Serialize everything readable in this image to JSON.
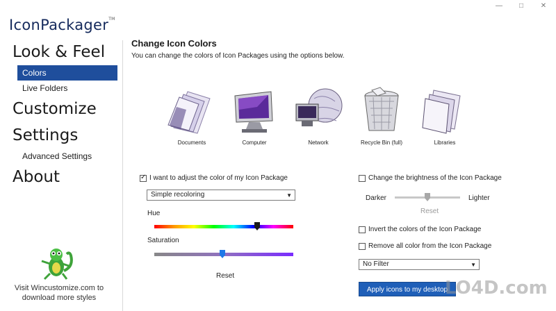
{
  "app": {
    "title": "IconPackager",
    "tm": "TM"
  },
  "window_controls": {
    "minimize": "—",
    "maximize": "□",
    "close": "✕"
  },
  "sidebar": {
    "sections": [
      {
        "label": "Look & Feel"
      },
      {
        "label": "Customize"
      },
      {
        "label": "Settings"
      },
      {
        "label": "About"
      }
    ],
    "subitems": [
      {
        "label": "Colors",
        "active": true
      },
      {
        "label": "Live Folders",
        "active": false
      },
      {
        "label": "Advanced Settings",
        "active": false
      }
    ],
    "promo": "Visit Wincustomize.com to download more styles"
  },
  "main": {
    "title": "Change Icon Colors",
    "description": "You can change the colors of Icon Packages using the options below.",
    "icons": [
      {
        "label": "Documents",
        "icon": "documents-icon"
      },
      {
        "label": "Computer",
        "icon": "computer-icon"
      },
      {
        "label": "Network",
        "icon": "network-icon"
      },
      {
        "label": "Recycle Bin (full)",
        "icon": "recycle-bin-icon"
      },
      {
        "label": "Libraries",
        "icon": "libraries-icon"
      }
    ],
    "adjust": {
      "checkbox_label": "I want to adjust the color of my Icon Package",
      "checked": true,
      "mode_value": "Simple recoloring",
      "hue_label": "Hue",
      "hue_level": 0.74,
      "saturation_label": "Saturation",
      "saturation_level": 0.49,
      "reset_label": "Reset"
    },
    "brightness": {
      "checkbox_label": "Change the brightness of the Icon Package",
      "checked": false,
      "darker_label": "Darker",
      "lighter_label": "Lighter",
      "level": 0.5,
      "reset_label": "Reset"
    },
    "invert": {
      "checkbox_label": "Invert the colors of the Icon Package",
      "checked": false
    },
    "remove_color": {
      "checkbox_label": "Remove all color from the Icon Package",
      "checked": false
    },
    "filter_value": "No Filter",
    "apply_label": "Apply icons to my desktop"
  },
  "watermark": "LO4D.com",
  "colors": {
    "accent": "#1f4e9c",
    "button": "#1f5fb8",
    "logo": "#152a5c"
  }
}
